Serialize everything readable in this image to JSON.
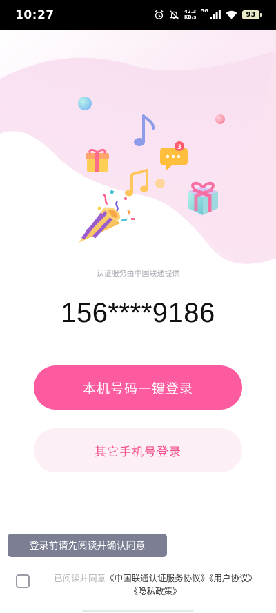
{
  "status_bar": {
    "time": "10:27",
    "net_speed_value": "42.3",
    "net_speed_unit": "KB/s",
    "network_label": "5G",
    "battery_level": "93"
  },
  "hero": {
    "illustration_icons": [
      "confetti-popper-icon",
      "gift-box-icon",
      "music-note-icon",
      "chat-bubble-icon",
      "bubble-icon"
    ],
    "notification_count": "3"
  },
  "provider_text": "认证服务由中国联通提供",
  "phone_number": "156****9186",
  "buttons": {
    "one_click_login": "本机号码一键登录",
    "other_phone_login": "其它手机号登录"
  },
  "tooltip": "登录前请先阅读并确认同意",
  "agreement": {
    "prefix": "已阅读并同意",
    "link_service": "《中国联通认证服务协议》",
    "link_user": "《用户协议》",
    "link_privacy": "《隐私政策》",
    "checked": false
  },
  "colors": {
    "primary": "#fd5b9f",
    "secondary_bg": "#fdeff6",
    "secondary_text": "#f4508f",
    "tooltip_bg": "#7c7f94"
  }
}
